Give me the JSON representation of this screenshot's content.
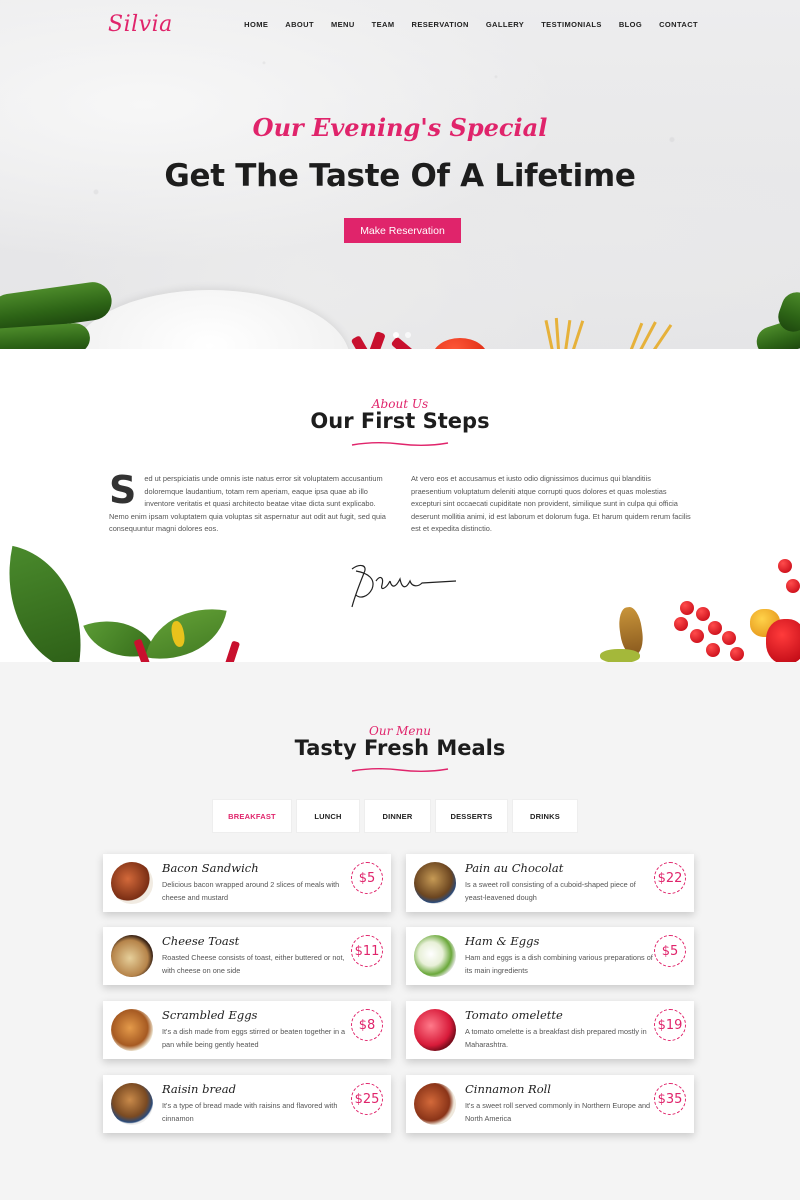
{
  "header": {
    "logo": "Silvia",
    "nav": [
      "HOME",
      "ABOUT",
      "MENU",
      "TEAM",
      "RESERVATION",
      "GALLERY",
      "TESTIMONIALS",
      "BLOG",
      "CONTACT"
    ]
  },
  "hero": {
    "subtitle": "Our Evening's Special",
    "title": "Get The Taste Of A Lifetime",
    "button": "Make Reservation",
    "slides": 2,
    "active_slide": 1
  },
  "about": {
    "kicker": "About Us",
    "title": "Our First Steps",
    "dropcap": "S",
    "col1": "ed ut perspiciatis unde omnis iste natus error sit voluptatem accusantium doloremque laudantium, totam rem aperiam, eaque ipsa quae ab illo inventore veritatis et quasi architecto beatae vitae dicta sunt explicabo. Nemo enim ipsam voluptatem quia voluptas sit aspernatur aut odit aut fugit, sed quia consequuntur magni dolores eos.",
    "col2": "At vero eos et accusamus et iusto odio dignissimos ducimus qui blanditiis praesentium voluptatum deleniti atque corrupti quos dolores et quas molestias excepturi sint occaecati cupiditate non provident, similique sunt in culpa qui officia deserunt mollitia animi, id est laborum et dolorum fuga. Et harum quidem rerum facilis est et expedita distinctio."
  },
  "menu": {
    "kicker": "Our Menu",
    "title": "Tasty Fresh Meals",
    "tabs": [
      "BREAKFAST",
      "LUNCH",
      "DINNER",
      "DESSERTS",
      "DRINKS"
    ],
    "active_tab": "BREAKFAST",
    "items": [
      {
        "name": "Bacon Sandwich",
        "desc": "Delicious bacon wrapped around 2 slices of meals with cheese and mustard",
        "price": "$5",
        "image": "bacon-sandwich-image"
      },
      {
        "name": "Pain au Chocolat",
        "desc": "Is a sweet roll consisting of a cuboid-shaped piece of yeast-leavened dough",
        "price": "$22",
        "image": "pain-au-chocolat-image"
      },
      {
        "name": "Cheese Toast",
        "desc": "Roasted Cheese consists of toast, either buttered or not, with cheese on one side",
        "price": "$11",
        "image": "cheese-toast-image"
      },
      {
        "name": "Ham & Eggs",
        "desc": "Ham and eggs is a dish combining various preparations of its main ingredients",
        "price": "$5",
        "image": "ham-eggs-image"
      },
      {
        "name": "Scrambled Eggs",
        "desc": "It's a dish made from eggs stirred or beaten together in a pan while being gently heated",
        "price": "$8",
        "image": "scrambled-eggs-image"
      },
      {
        "name": "Tomato omelette",
        "desc": "A tomato omelette is a breakfast dish prepared mostly in Maharashtra.",
        "price": "$19",
        "image": "tomato-omelette-image"
      },
      {
        "name": "Raisin bread",
        "desc": "It's a type of bread made with raisins and flavored with cinnamon",
        "price": "$25",
        "image": "raisin-bread-image"
      },
      {
        "name": "Cinnamon Roll",
        "desc": "It's a sweet roll served commonly in Northern Europe and North America",
        "price": "$35",
        "image": "cinnamon-roll-image"
      }
    ]
  },
  "colors": {
    "accent": "#e0246b",
    "text": "#1d1d1d",
    "muted": "#555555",
    "menu_bg": "#f4f4f4"
  }
}
